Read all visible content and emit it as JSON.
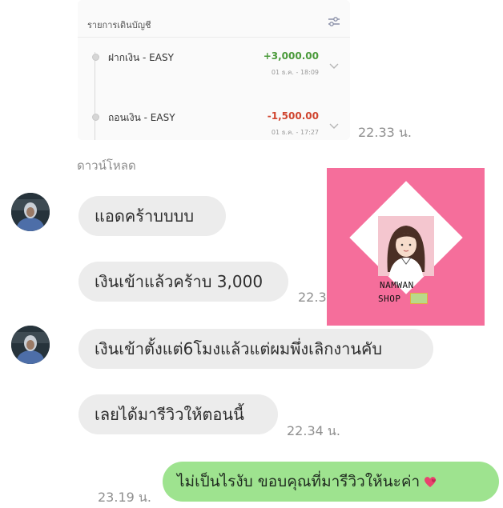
{
  "statement": {
    "title": "รายการเดินบัญชี",
    "transactions": [
      {
        "name": "ฝากเงิน - EASY",
        "amount": "+3,000.00",
        "date": "01 ธ.ค. - 18:09",
        "amount_color": "#4a9a3a"
      },
      {
        "name": "ถอนเงิน - EASY",
        "amount": "-1,500.00",
        "date": "01 ธ.ค. - 17:27",
        "amount_color": "#d0452f"
      }
    ],
    "time": "22.33 น."
  },
  "download_label": "ดาวน์โหลด",
  "messages": [
    {
      "text": "แอดคร้าบบบบ"
    },
    {
      "text": "เงินเข้าแล้วคร้าบ 3,000",
      "time": "22.33 น."
    },
    {
      "text": "เงินเข้าตั้งแต่6โมงแล้วแต่ผมพึ่งเลิกงานคับ"
    },
    {
      "text": "เลยได้มารีวิวให้ตอนนี้",
      "time": "22.34 น."
    }
  ],
  "reply": {
    "text": "ไม่เป็นไรงับ ขอบคุณที่มารีวิวให้นะค่า",
    "time": "23.19 น."
  },
  "watermark": {
    "line1": "NAMWAN",
    "line2": "SHOP"
  },
  "colors": {
    "bubble": "#ececec",
    "reply_bubble": "#9ee38f",
    "watermark_bg": "#f56e9b"
  },
  "icons": {
    "filter": "sliders-icon",
    "expand": "chevron-down-icon",
    "heart": "heart-icon",
    "money": "money-bill-icon"
  }
}
